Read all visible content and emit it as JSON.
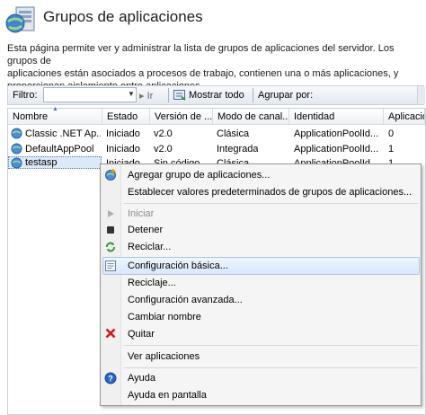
{
  "header": {
    "title": "Grupos de aplicaciones",
    "description_lines": [
      "Esta página permite ver y administrar la lista de grupos de aplicaciones del servidor. Los grupos de",
      "aplicaciones están asociados a procesos de trabajo, contienen una o más aplicaciones, y",
      "proporcionan aislamiento entre aplicaciones."
    ]
  },
  "toolbar": {
    "filter_label": "Filtro:",
    "filter_value": "",
    "go_label": "Ir",
    "show_all_label": "Mostrar todo",
    "group_by_label": "Agrupar por:"
  },
  "grid": {
    "columns": [
      "Nombre",
      "Estado",
      "Versión de ...",
      "Modo de canal...",
      "Identidad",
      "Aplicaciones"
    ],
    "rows": [
      {
        "name": "Classic .NET Ap...",
        "status": "Iniciado",
        "version": "v2.0",
        "mode": "Clásica",
        "identity": "ApplicationPoolId...",
        "apps": "0"
      },
      {
        "name": "DefaultAppPool",
        "status": "Iniciado",
        "version": "v2.0",
        "mode": "Integrada",
        "identity": "ApplicationPoolId...",
        "apps": "1"
      },
      {
        "name": "testasp",
        "status": "Iniciado",
        "version": "Sin código...",
        "mode": "Clásica",
        "identity": "ApplicationPoolId...",
        "apps": "1"
      }
    ]
  },
  "context_menu": {
    "items": [
      {
        "label": "Agregar grupo de aplicaciones...",
        "icon": "add-pool-icon",
        "enabled": true
      },
      {
        "label": "Establecer valores predeterminados de grupos de aplicaciones...",
        "icon": "",
        "enabled": true
      },
      {
        "label": "Iniciar",
        "icon": "play-icon",
        "enabled": false
      },
      {
        "label": "Detener",
        "icon": "stop-icon",
        "enabled": true
      },
      {
        "label": "Reciclar...",
        "icon": "recycle-icon",
        "enabled": true
      },
      {
        "label": "Configuración básica...",
        "icon": "settings-page-icon",
        "enabled": true,
        "highlighted": true
      },
      {
        "label": "Reciclaje...",
        "icon": "",
        "enabled": true
      },
      {
        "label": "Configuración avanzada...",
        "icon": "",
        "enabled": true
      },
      {
        "label": "Cambiar nombre",
        "icon": "",
        "enabled": true
      },
      {
        "label": "Quitar",
        "icon": "remove-x-icon",
        "enabled": true
      },
      {
        "label": "Ver aplicaciones",
        "icon": "",
        "enabled": true
      },
      {
        "label": "Ayuda",
        "icon": "help-icon",
        "enabled": true
      },
      {
        "label": "Ayuda en pantalla",
        "icon": "",
        "enabled": true
      }
    ]
  }
}
